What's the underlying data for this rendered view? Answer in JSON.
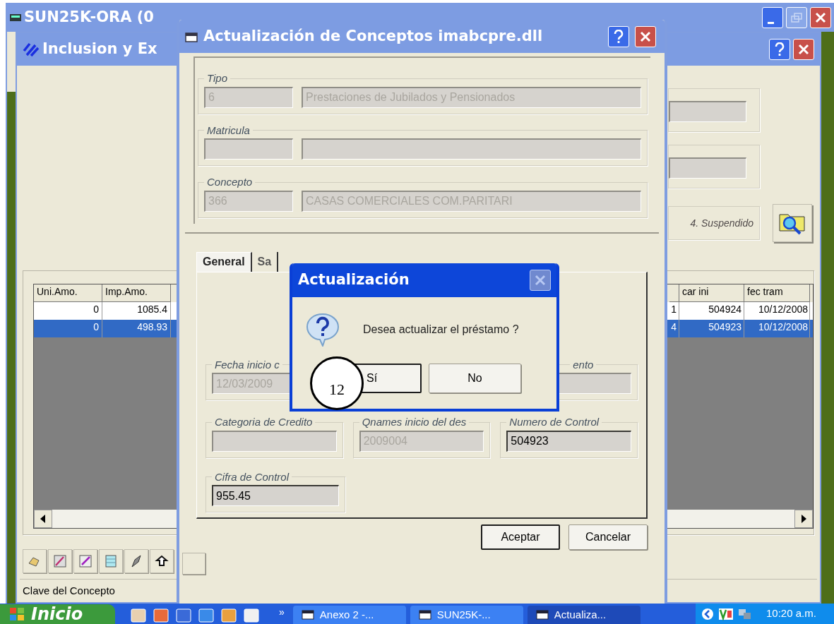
{
  "main_window": {
    "title": "SUN25K-ORA  (0"
  },
  "inclusion_window": {
    "title": "Inclusion y Ex",
    "right_groups": [
      {
        "fields": [
          {
            "disabled": true
          }
        ]
      },
      {
        "fields": [
          {
            "disabled": true
          }
        ]
      }
    ],
    "status_label": "4. Suspendido",
    "table": {
      "left_columns": [
        "Uni.Amo.",
        "Imp.Amo."
      ],
      "right_columns": [
        "car ini",
        "fec tram"
      ],
      "rows": [
        {
          "selected": false,
          "cells": [
            "0",
            "1085.4",
            "1",
            "504924",
            "10/12/2008"
          ]
        },
        {
          "selected": true,
          "cells": [
            "0",
            "498.93",
            "4",
            "504923",
            "10/12/2008"
          ]
        }
      ]
    },
    "status_bar": "Clave del Concepto"
  },
  "dialog": {
    "title": "Actualización de Conceptos imabcpre.dll",
    "groups": [
      {
        "label": "Tipo",
        "fields": [
          {
            "value": "6",
            "disabled": true
          },
          {
            "value": "Prestaciones de Jubilados y Pensionados",
            "disabled": true
          }
        ]
      },
      {
        "label": "Matricula",
        "fields": [
          {
            "disabled": true
          },
          {
            "disabled": true
          }
        ]
      },
      {
        "label": "Concepto",
        "fields": [
          {
            "value": "366",
            "disabled": true
          },
          {
            "value": "CASAS COMERCIALES COM.PARITARI",
            "disabled": true
          }
        ]
      }
    ],
    "tabs": [
      {
        "label": "General",
        "selected": true
      },
      {
        "label": "Sa",
        "selected": false
      }
    ],
    "tab_fields": [
      {
        "label": "Fecha inicio c",
        "value": "12/03/2009",
        "disabled": true
      },
      {
        "label": "ento",
        "disabled": true
      },
      {
        "label": "Categoria de Credito",
        "disabled": true
      },
      {
        "label": "Qnames inicio del des",
        "value": "2009004",
        "disabled": true
      },
      {
        "label": "Numero de Control",
        "value": "504923",
        "disabled": false
      },
      {
        "label": "Cifra de Control",
        "value": "955.45",
        "disabled": false
      }
    ],
    "buttons": [
      {
        "label": "Aceptar",
        "focused": true
      },
      {
        "label": "Cancelar",
        "focused": false
      }
    ]
  },
  "message_box": {
    "title": "Actualización",
    "message": "Desea actualizar el préstamo ?",
    "buttons": [
      {
        "label": "Sí",
        "focused": true
      },
      {
        "label": "No",
        "focused": false
      }
    ]
  },
  "annotation": "12",
  "taskbar": {
    "start": "Inicio",
    "more": "»",
    "tasks": [
      {
        "label": "Anexo 2 -...",
        "selected": false
      },
      {
        "label": "SUN25K-...",
        "selected": false
      },
      {
        "label": "Actualiza...",
        "selected": true
      }
    ],
    "clock": "10:20 a.m."
  }
}
